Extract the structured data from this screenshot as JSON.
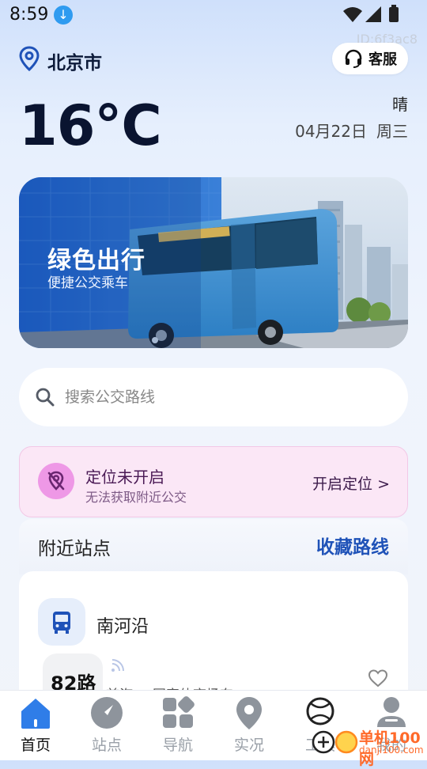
{
  "status_bar": {
    "time": "8:59"
  },
  "watermark_id": "ID:6f3ac8",
  "header": {
    "city": "北京市",
    "service_label": "客服"
  },
  "weather": {
    "temperature": "16°C",
    "condition": "晴",
    "date": "04月22日",
    "weekday": "周三"
  },
  "banner": {
    "title": "绿色出行",
    "subtitle": "便捷公交乘车"
  },
  "search": {
    "placeholder": "搜索公交路线"
  },
  "location_notice": {
    "title": "定位未开启",
    "subtitle": "无法获取附近公交",
    "action": "开启定位 >"
  },
  "nearby": {
    "title": "附近站点",
    "favorites_link": "收藏路线",
    "stop": {
      "name": "南河沿",
      "route": "82路",
      "direction": "首汽 → 国家体育场东"
    }
  },
  "bottom_nav": {
    "items": [
      {
        "label": "首页",
        "icon": "home-icon",
        "active": true
      },
      {
        "label": "站点",
        "icon": "compass-icon",
        "active": false
      },
      {
        "label": "导航",
        "icon": "grid-icon",
        "active": false
      },
      {
        "label": "实况",
        "icon": "map-pin-icon",
        "active": false
      },
      {
        "label": "工具",
        "icon": "ball-icon",
        "active": false
      },
      {
        "label": "我的",
        "icon": "user-icon",
        "active": false
      }
    ]
  },
  "site_watermark": {
    "line1": "单机100网",
    "line2": "danji100.com"
  },
  "colors": {
    "accent": "#1f52b8",
    "nav_active": "#2f7de8",
    "location_card_bg": "#fbe7f6",
    "location_icon_bg": "#ee98e6"
  }
}
